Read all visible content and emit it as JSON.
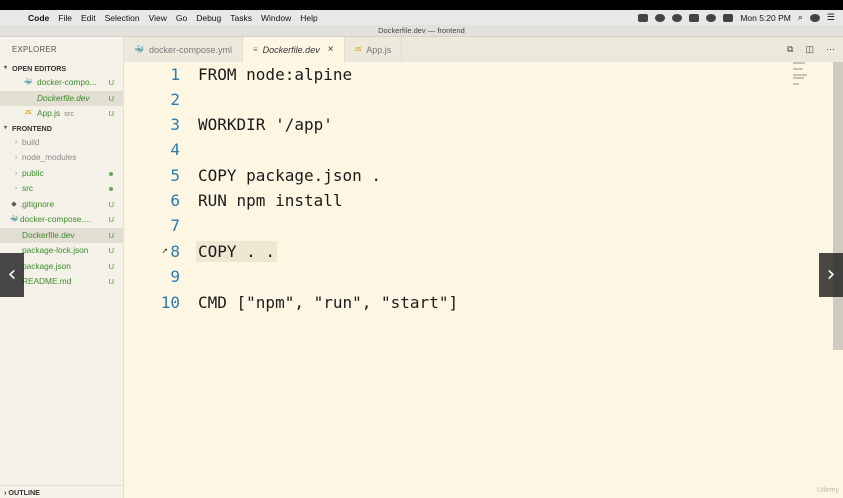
{
  "menubar": {
    "app": "Code",
    "items": [
      "File",
      "Edit",
      "Selection",
      "View",
      "Go",
      "Debug",
      "Tasks",
      "Window",
      "Help"
    ],
    "clock": "Mon 5:20 PM"
  },
  "window": {
    "title": "Dockerfile.dev — frontend"
  },
  "sidebar": {
    "explorer_title": "EXPLORER",
    "open_editors_title": "OPEN EDITORS",
    "open_editors": [
      {
        "label": "docker-compo...",
        "badge": "U",
        "icon": "docker-icon"
      },
      {
        "label": "Dockerfile.dev",
        "badge": "U",
        "icon": "none"
      },
      {
        "label": "App.js",
        "sub": "src",
        "badge": "U",
        "icon": "js-icon"
      }
    ],
    "folder_title": "FRONTEND",
    "files": [
      {
        "label": "build",
        "type": "folder"
      },
      {
        "label": "node_modules",
        "type": "folder"
      },
      {
        "label": "public",
        "type": "folder"
      },
      {
        "label": "src",
        "type": "folder"
      },
      {
        "label": ".gitignore",
        "badge": "U"
      },
      {
        "label": "docker-compose....",
        "badge": "U"
      },
      {
        "label": "Dockerfile.dev",
        "badge": "U"
      },
      {
        "label": "package-lock.json",
        "badge": "U"
      },
      {
        "label": "package.json",
        "badge": "U"
      },
      {
        "label": "README.md",
        "badge": "U"
      }
    ],
    "outline_title": "OUTLINE"
  },
  "tabs": [
    {
      "label": "docker-compose.yml"
    },
    {
      "label": "Dockerfile.dev",
      "close": "×"
    },
    {
      "label": "App.js",
      "icon_text": "JS"
    }
  ],
  "editor": {
    "lines": [
      {
        "n": "1",
        "text": "FROM node:alpine"
      },
      {
        "n": "2",
        "text": ""
      },
      {
        "n": "3",
        "text": "WORKDIR '/app'"
      },
      {
        "n": "4",
        "text": ""
      },
      {
        "n": "5",
        "text": "COPY package.json ."
      },
      {
        "n": "6",
        "text": "RUN npm install"
      },
      {
        "n": "7",
        "text": ""
      },
      {
        "n": "8",
        "text": "COPY . ."
      },
      {
        "n": "9",
        "text": ""
      },
      {
        "n": "10",
        "text": "CMD [\"npm\", \"run\", \"start\"]"
      }
    ],
    "watermark": "Udemy"
  },
  "colors": {
    "editor_bg": "#fdf6e3",
    "line_number": "#2a7bb0",
    "git_untracked": "#3d8b2c"
  }
}
